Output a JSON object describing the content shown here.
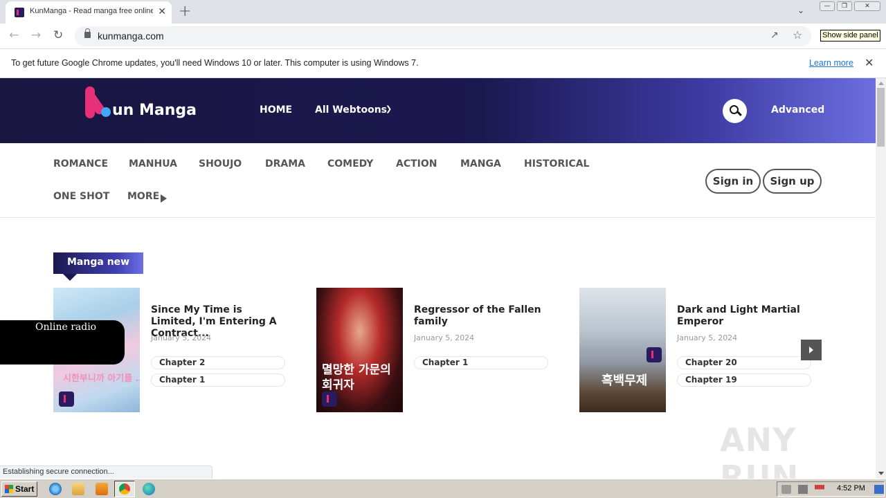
{
  "browser": {
    "tab_title": "KunManga - Read manga free online",
    "tab_close": "✕",
    "new_tab": "+",
    "url": "kunmanga.com",
    "side_panel_tooltip": "Show side panel",
    "infobar_message": "To get future Google Chrome updates, you'll need Windows 10 or later. This computer is using Windows 7.",
    "infobar_link": "Learn more",
    "infobar_close": "✕",
    "status_text": "Establishing secure connection..."
  },
  "site": {
    "logo_text": "un Manga",
    "nav": {
      "home": "HOME",
      "all_webtoons": "All Webtoons",
      "advanced": "Advanced"
    },
    "genres": [
      "ROMANCE",
      "MANHUA",
      "SHOUJO",
      "DRAMA",
      "COMEDY",
      "ACTION",
      "MANGA",
      "HISTORICAL",
      "ONE SHOT",
      "MORE"
    ],
    "auth": {
      "sign_in": "Sign in",
      "sign_up": "Sign up"
    },
    "section_title": "Manga new",
    "cards": [
      {
        "title": "Since My Time is Limited, I'm Entering A Contract...",
        "date": "January 5, 2024",
        "chapters": [
          "Chapter 2",
          "Chapter 1"
        ]
      },
      {
        "title": "Regressor of the Fallen family",
        "date": "January 5, 2024",
        "chapters": [
          "Chapter 1"
        ]
      },
      {
        "title": "Dark and Light Martial Emperor",
        "date": "January 5, 2024",
        "chapters": [
          "Chapter 20",
          "Chapter 19"
        ]
      }
    ],
    "cover_texts": {
      "c1": "시한부니까 아기를 …",
      "c2": "멸망한 가문의 회귀자",
      "c3": "흑백무제"
    },
    "radio_label": "Online radio"
  },
  "watermark": "ANY RUN",
  "taskbar": {
    "start_label": "Start",
    "time": "4:52 PM"
  },
  "colors": {
    "header_dark": "#191640",
    "header_light": "#6d6ee0",
    "accent_pink": "#e6307a",
    "accent_blue": "#3fa9f5"
  }
}
